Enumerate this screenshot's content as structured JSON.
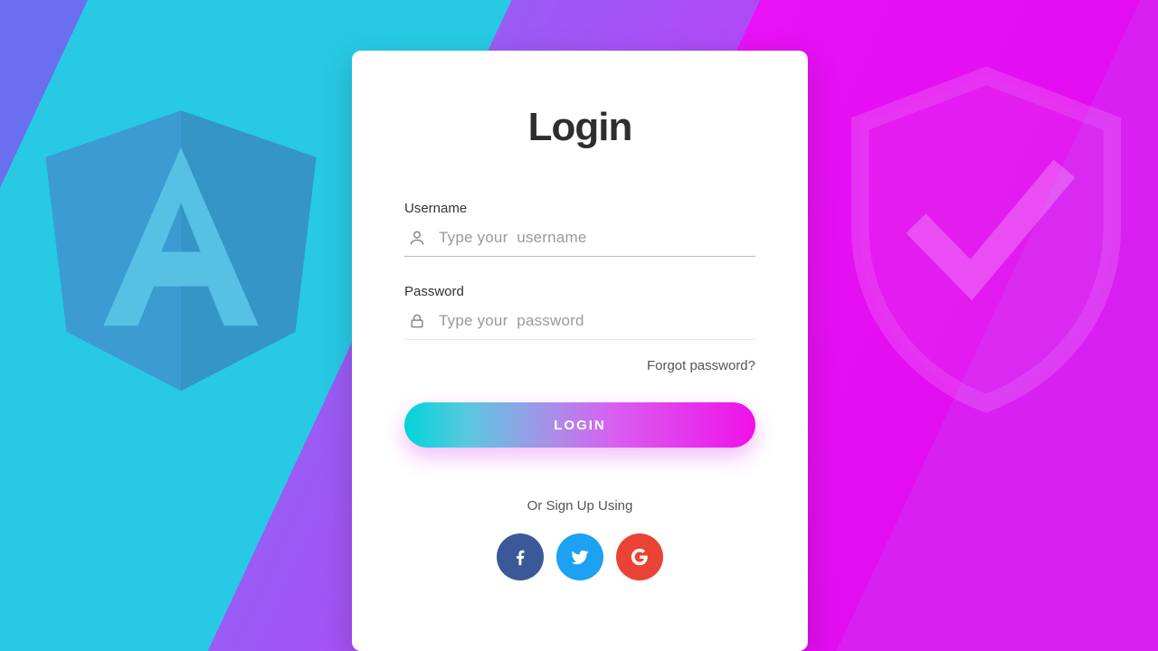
{
  "title": "Login",
  "username": {
    "label": "Username",
    "placeholder": "Type your  username",
    "value": ""
  },
  "password": {
    "label": "Password",
    "placeholder": "Type your  password",
    "value": ""
  },
  "forgot": "Forgot password?",
  "login_button": "LOGIN",
  "signup_prompt": "Or Sign Up Using",
  "social": {
    "facebook": "facebook",
    "twitter": "twitter",
    "google": "google"
  }
}
